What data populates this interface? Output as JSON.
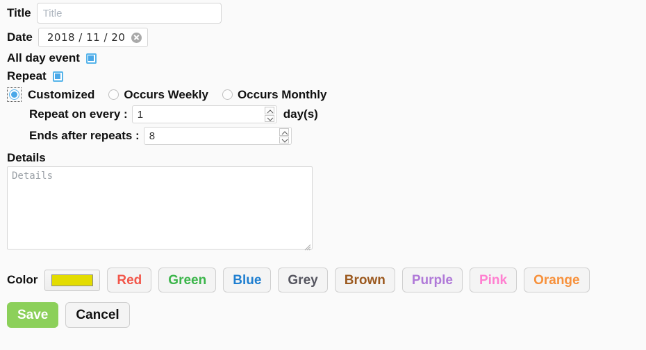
{
  "form": {
    "title": {
      "label": "Title",
      "value": "",
      "placeholder": "Title"
    },
    "date": {
      "label": "Date",
      "value": "2018 / 11 / 20",
      "clear_icon": "clear-circle-icon"
    },
    "all_day": {
      "label": "All day event",
      "checked": true
    },
    "repeat": {
      "label": "Repeat",
      "checked": true
    },
    "repeat_mode": {
      "selected": "Customized",
      "options": [
        {
          "label": "Customized",
          "checked": true,
          "focused": true
        },
        {
          "label": "Occurs Weekly",
          "checked": false,
          "focused": false
        },
        {
          "label": "Occurs Monthly",
          "checked": false,
          "focused": false
        }
      ]
    },
    "repeat_every": {
      "label": "Repeat on every :",
      "value": "1",
      "unit": "day(s)"
    },
    "ends_after": {
      "label": "Ends after repeats :",
      "value": "8"
    },
    "details": {
      "label": "Details",
      "value": "",
      "placeholder": "Details"
    },
    "color": {
      "label": "Color",
      "swatch_value": "#e3dc00",
      "buttons": [
        {
          "label": "Red",
          "text_color": "#f2564a"
        },
        {
          "label": "Green",
          "text_color": "#3bb54a"
        },
        {
          "label": "Blue",
          "text_color": "#1f7fd0"
        },
        {
          "label": "Grey",
          "text_color": "#55555f"
        },
        {
          "label": "Brown",
          "text_color": "#9c5a20"
        },
        {
          "label": "Purple",
          "text_color": "#b07ad8"
        },
        {
          "label": "Pink",
          "text_color": "#ff7fd0"
        },
        {
          "label": "Orange",
          "text_color": "#f7913c"
        }
      ]
    },
    "actions": {
      "save": "Save",
      "cancel": "Cancel"
    }
  },
  "theme": {
    "page_bg": "#fafafa",
    "accent_blue": "#4aa8e8",
    "save_green": "#8cd05a"
  }
}
